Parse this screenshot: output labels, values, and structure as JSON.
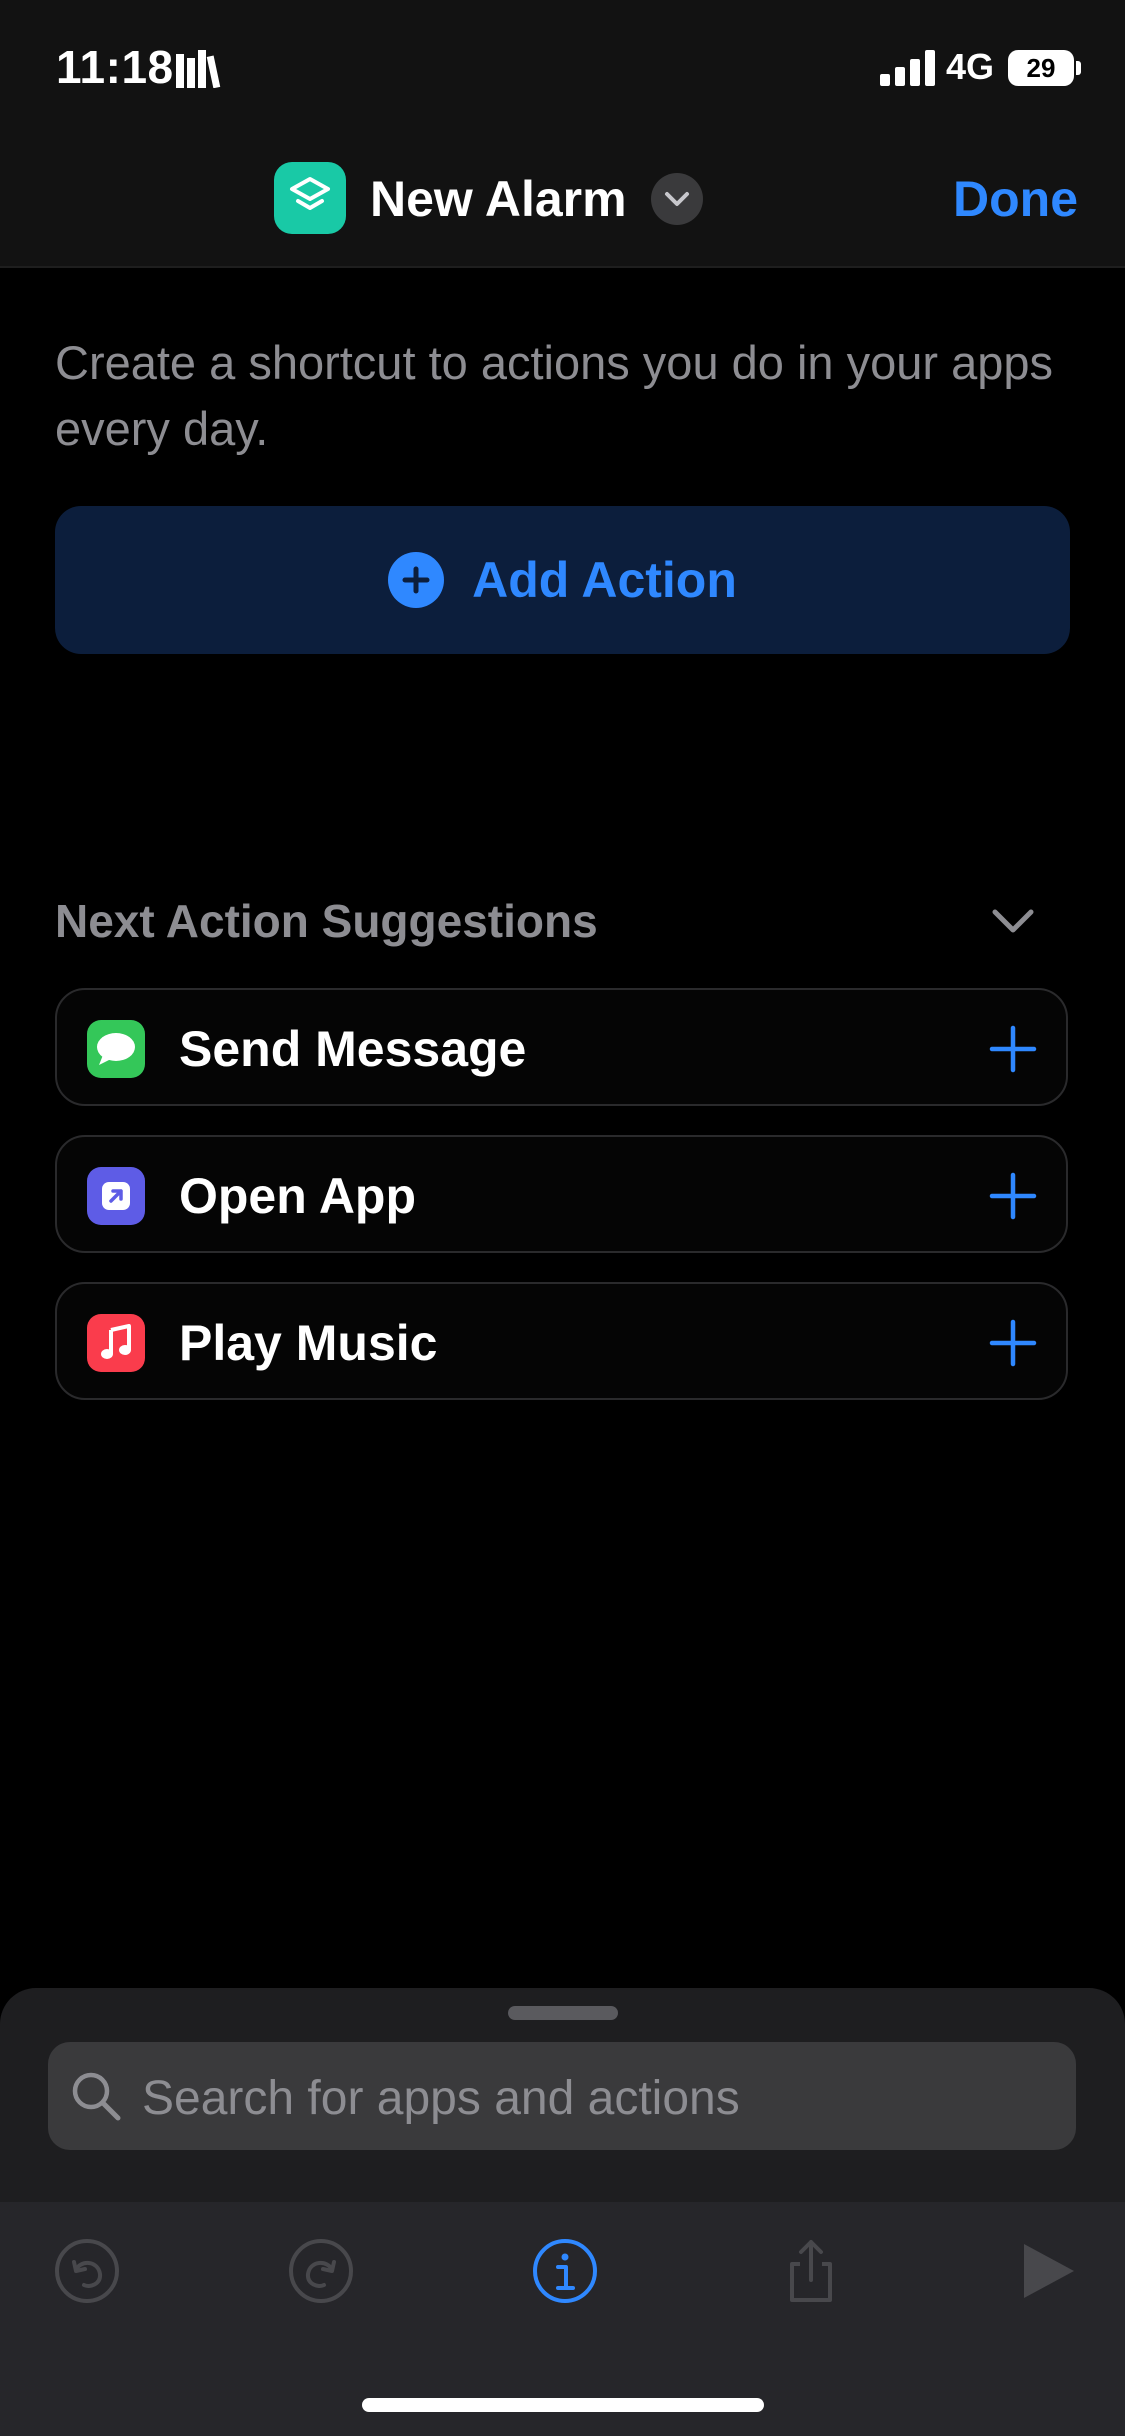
{
  "status_bar": {
    "time": "11:18",
    "network": "4G",
    "battery": "29",
    "icons": [
      "library-icon",
      "signal-icon",
      "battery-icon"
    ]
  },
  "nav": {
    "title": "New Alarm",
    "done_label": "Done",
    "app_icon": "shortcuts-icon",
    "accent": "#2f88ff"
  },
  "main": {
    "intro": "Create a shortcut to actions you do in your apps every day.",
    "add_action_label": "Add Action",
    "suggestions_header": "Next Action Suggestions",
    "suggestions": [
      {
        "label": "Send Message",
        "icon": "messages-icon",
        "color": "#34c759"
      },
      {
        "label": "Open App",
        "icon": "open-app-icon",
        "color": "#5e5ce6"
      },
      {
        "label": "Play Music",
        "icon": "music-icon",
        "color": "#fa3c4c"
      }
    ]
  },
  "search": {
    "placeholder": "Search for apps and actions"
  },
  "toolbar": {
    "buttons": [
      "undo-icon",
      "redo-icon",
      "info-icon",
      "share-icon",
      "play-icon"
    ]
  }
}
